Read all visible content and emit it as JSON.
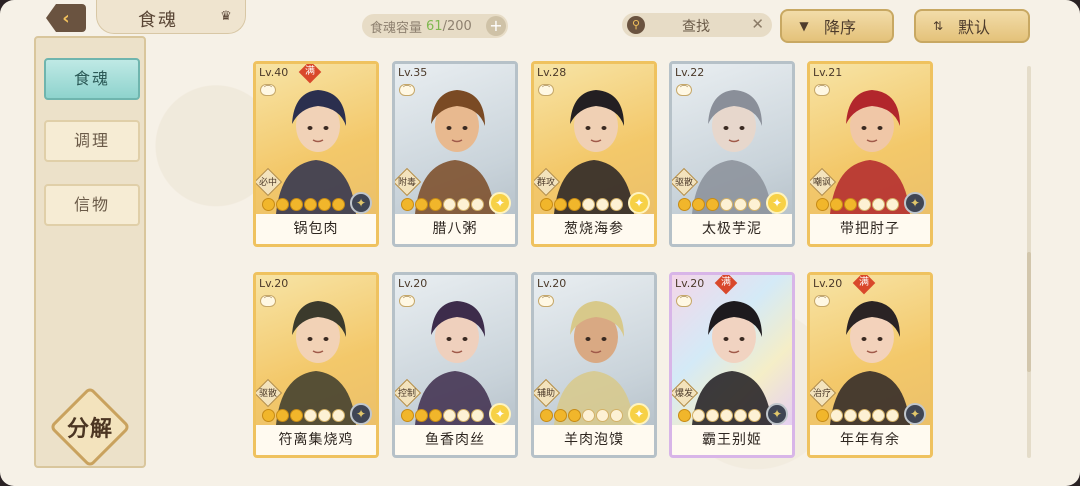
{
  "header": {
    "back_icon": "back-arrow-icon",
    "title": "食魂",
    "capacity_label": "食魂容量",
    "capacity_current": "61",
    "capacity_max": "/200",
    "search_placeholder": "查找",
    "sort_order_label": "降序",
    "sort_default_label": "默认"
  },
  "sidebar": {
    "items": [
      {
        "label": "食魂"
      },
      {
        "label": "调理"
      },
      {
        "label": "信物"
      }
    ],
    "decompose_label": "分解"
  },
  "cards": [
    {
      "level": "Lv.40",
      "full": true,
      "role": "必中",
      "name": "锅包肉",
      "stars_filled": 6,
      "element": "dark",
      "rarity": "gold"
    },
    {
      "level": "Lv.35",
      "full": false,
      "role": "附毒",
      "name": "腊八粥",
      "stars_filled": 3,
      "element": "light",
      "rarity": "silver"
    },
    {
      "level": "Lv.28",
      "full": false,
      "role": "群攻",
      "name": "葱烧海参",
      "stars_filled": 3,
      "element": "light",
      "rarity": "gold"
    },
    {
      "level": "Lv.22",
      "full": false,
      "role": "驱散",
      "name": "太极芋泥",
      "stars_filled": 3,
      "element": "light",
      "rarity": "silver"
    },
    {
      "level": "Lv.21",
      "full": false,
      "role": "嘲讽",
      "name": "带把肘子",
      "stars_filled": 3,
      "element": "dark",
      "rarity": "gold"
    },
    {
      "level": "Lv.20",
      "full": false,
      "role": "驱散",
      "name": "符离集烧鸡",
      "stars_filled": 3,
      "element": "dark",
      "rarity": "gold"
    },
    {
      "level": "Lv.20",
      "full": false,
      "role": "控制",
      "name": "鱼香肉丝",
      "stars_filled": 3,
      "element": "light",
      "rarity": "silver"
    },
    {
      "level": "Lv.20",
      "full": false,
      "role": "辅助",
      "name": "羊肉泡馍",
      "stars_filled": 3,
      "element": "light",
      "rarity": "silver"
    },
    {
      "level": "Lv.20",
      "full": true,
      "role": "爆发",
      "name": "霸王别姬",
      "stars_filled": 1,
      "element": "dark",
      "rarity": "rainbow"
    },
    {
      "level": "Lv.20",
      "full": true,
      "role": "治疗",
      "name": "年年有余",
      "stars_filled": 1,
      "element": "dark",
      "rarity": "gold"
    }
  ],
  "colors": {
    "accent_gold": "#efc25f",
    "active_tab": "#8ed3cd",
    "capacity_current": "#7fb94f"
  }
}
